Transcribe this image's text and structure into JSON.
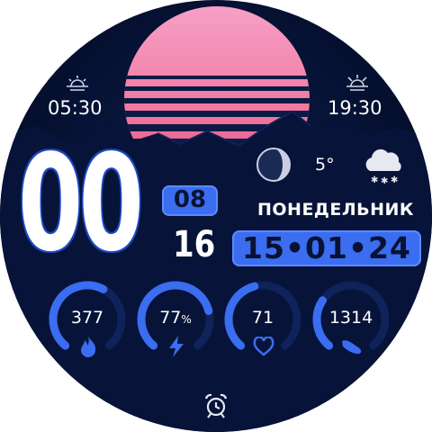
{
  "sun": {
    "sunrise": "05:30",
    "sunset": "19:30",
    "sunrise_icon": "sunrise-icon",
    "sunset_icon": "sunset-icon"
  },
  "clock": {
    "hour": "00",
    "minute": "08",
    "second": "16"
  },
  "date": {
    "weekday": "ПОНЕДЕЛЬНИК",
    "date": "15•01•24"
  },
  "weather": {
    "moon_icon": "moon-phase-icon",
    "temperature": "5°",
    "condition_icon": "snow-cloud-icon"
  },
  "stats": [
    {
      "value": "377",
      "unit": "",
      "icon": "flame-icon",
      "progress": 0.6
    },
    {
      "value": "77",
      "unit": "%",
      "icon": "lightning-icon",
      "progress": 0.77
    },
    {
      "value": "71",
      "unit": "",
      "icon": "heart-icon",
      "progress": 0.45
    },
    {
      "value": "1314",
      "unit": "",
      "icon": "footsteps-icon",
      "progress": 0.3
    }
  ],
  "alarm": {
    "icon": "alarm-clock-icon"
  },
  "colors": {
    "accent": "#3a6df0",
    "accent_light": "#5b8bff",
    "ring_track": "#0f2259",
    "sun_pink": "#f27ea5"
  }
}
